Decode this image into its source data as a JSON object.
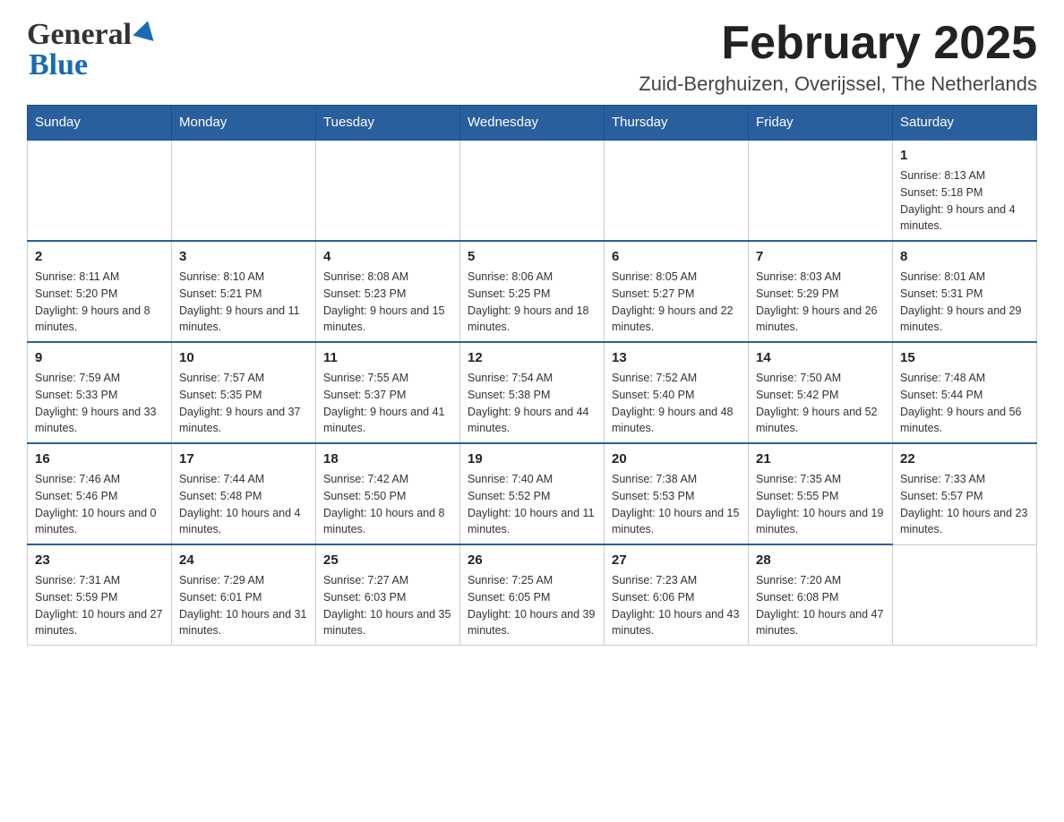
{
  "header": {
    "logo_general": "General",
    "logo_blue": "Blue",
    "main_title": "February 2025",
    "subtitle": "Zuid-Berghuizen, Overijssel, The Netherlands"
  },
  "weekdays": [
    "Sunday",
    "Monday",
    "Tuesday",
    "Wednesday",
    "Thursday",
    "Friday",
    "Saturday"
  ],
  "weeks": [
    {
      "days": [
        {
          "number": "",
          "info": ""
        },
        {
          "number": "",
          "info": ""
        },
        {
          "number": "",
          "info": ""
        },
        {
          "number": "",
          "info": ""
        },
        {
          "number": "",
          "info": ""
        },
        {
          "number": "",
          "info": ""
        },
        {
          "number": "1",
          "info": "Sunrise: 8:13 AM\nSunset: 5:18 PM\nDaylight: 9 hours and 4 minutes."
        }
      ]
    },
    {
      "days": [
        {
          "number": "2",
          "info": "Sunrise: 8:11 AM\nSunset: 5:20 PM\nDaylight: 9 hours and 8 minutes."
        },
        {
          "number": "3",
          "info": "Sunrise: 8:10 AM\nSunset: 5:21 PM\nDaylight: 9 hours and 11 minutes."
        },
        {
          "number": "4",
          "info": "Sunrise: 8:08 AM\nSunset: 5:23 PM\nDaylight: 9 hours and 15 minutes."
        },
        {
          "number": "5",
          "info": "Sunrise: 8:06 AM\nSunset: 5:25 PM\nDaylight: 9 hours and 18 minutes."
        },
        {
          "number": "6",
          "info": "Sunrise: 8:05 AM\nSunset: 5:27 PM\nDaylight: 9 hours and 22 minutes."
        },
        {
          "number": "7",
          "info": "Sunrise: 8:03 AM\nSunset: 5:29 PM\nDaylight: 9 hours and 26 minutes."
        },
        {
          "number": "8",
          "info": "Sunrise: 8:01 AM\nSunset: 5:31 PM\nDaylight: 9 hours and 29 minutes."
        }
      ]
    },
    {
      "days": [
        {
          "number": "9",
          "info": "Sunrise: 7:59 AM\nSunset: 5:33 PM\nDaylight: 9 hours and 33 minutes."
        },
        {
          "number": "10",
          "info": "Sunrise: 7:57 AM\nSunset: 5:35 PM\nDaylight: 9 hours and 37 minutes."
        },
        {
          "number": "11",
          "info": "Sunrise: 7:55 AM\nSunset: 5:37 PM\nDaylight: 9 hours and 41 minutes."
        },
        {
          "number": "12",
          "info": "Sunrise: 7:54 AM\nSunset: 5:38 PM\nDaylight: 9 hours and 44 minutes."
        },
        {
          "number": "13",
          "info": "Sunrise: 7:52 AM\nSunset: 5:40 PM\nDaylight: 9 hours and 48 minutes."
        },
        {
          "number": "14",
          "info": "Sunrise: 7:50 AM\nSunset: 5:42 PM\nDaylight: 9 hours and 52 minutes."
        },
        {
          "number": "15",
          "info": "Sunrise: 7:48 AM\nSunset: 5:44 PM\nDaylight: 9 hours and 56 minutes."
        }
      ]
    },
    {
      "days": [
        {
          "number": "16",
          "info": "Sunrise: 7:46 AM\nSunset: 5:46 PM\nDaylight: 10 hours and 0 minutes."
        },
        {
          "number": "17",
          "info": "Sunrise: 7:44 AM\nSunset: 5:48 PM\nDaylight: 10 hours and 4 minutes."
        },
        {
          "number": "18",
          "info": "Sunrise: 7:42 AM\nSunset: 5:50 PM\nDaylight: 10 hours and 8 minutes."
        },
        {
          "number": "19",
          "info": "Sunrise: 7:40 AM\nSunset: 5:52 PM\nDaylight: 10 hours and 11 minutes."
        },
        {
          "number": "20",
          "info": "Sunrise: 7:38 AM\nSunset: 5:53 PM\nDaylight: 10 hours and 15 minutes."
        },
        {
          "number": "21",
          "info": "Sunrise: 7:35 AM\nSunset: 5:55 PM\nDaylight: 10 hours and 19 minutes."
        },
        {
          "number": "22",
          "info": "Sunrise: 7:33 AM\nSunset: 5:57 PM\nDaylight: 10 hours and 23 minutes."
        }
      ]
    },
    {
      "days": [
        {
          "number": "23",
          "info": "Sunrise: 7:31 AM\nSunset: 5:59 PM\nDaylight: 10 hours and 27 minutes."
        },
        {
          "number": "24",
          "info": "Sunrise: 7:29 AM\nSunset: 6:01 PM\nDaylight: 10 hours and 31 minutes."
        },
        {
          "number": "25",
          "info": "Sunrise: 7:27 AM\nSunset: 6:03 PM\nDaylight: 10 hours and 35 minutes."
        },
        {
          "number": "26",
          "info": "Sunrise: 7:25 AM\nSunset: 6:05 PM\nDaylight: 10 hours and 39 minutes."
        },
        {
          "number": "27",
          "info": "Sunrise: 7:23 AM\nSunset: 6:06 PM\nDaylight: 10 hours and 43 minutes."
        },
        {
          "number": "28",
          "info": "Sunrise: 7:20 AM\nSunset: 6:08 PM\nDaylight: 10 hours and 47 minutes."
        },
        {
          "number": "",
          "info": ""
        }
      ]
    }
  ]
}
